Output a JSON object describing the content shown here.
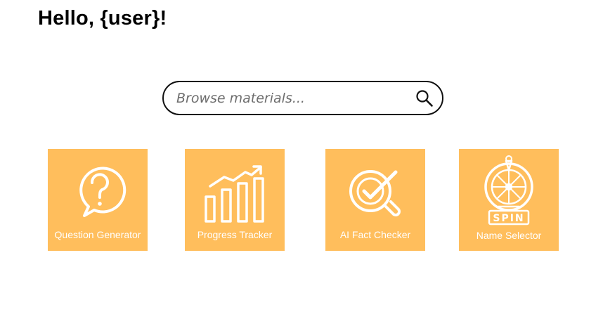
{
  "header": {
    "greeting": "Hello, {user}!"
  },
  "search": {
    "placeholder": "Browse materials...",
    "value": ""
  },
  "tiles": [
    {
      "label": "Question Generator",
      "icon": "question-bubble-icon"
    },
    {
      "label": "Progress Tracker",
      "icon": "bar-chart-trend-icon"
    },
    {
      "label": "AI Fact Checker",
      "icon": "magnifier-check-icon"
    },
    {
      "label": "Name Selector",
      "icon": "spin-wheel-icon"
    }
  ],
  "colors": {
    "tile_background": "#ffbe5c",
    "tile_foreground": "#ffffff",
    "text": "#000000"
  }
}
